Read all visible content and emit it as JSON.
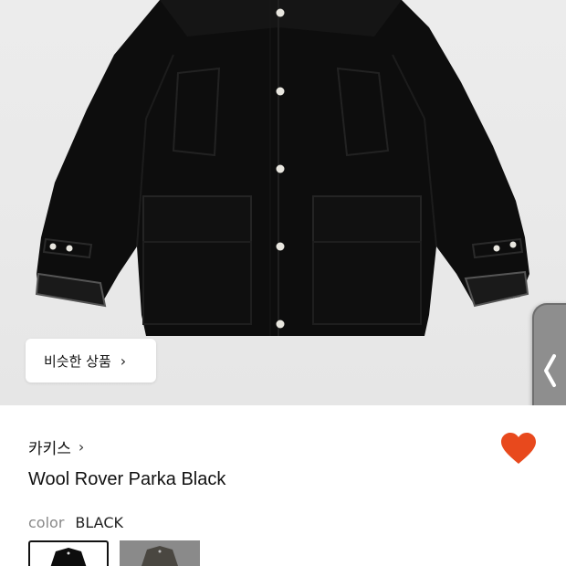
{
  "similar_products": {
    "label": "비슷한 상품",
    "chevron": "›"
  },
  "product": {
    "brand": "카키스",
    "brand_chevron": "›",
    "name": "Wool Rover Parka Black",
    "color_label": "color",
    "color_value": "BLACK"
  },
  "icons": {
    "wishlist": "heart-icon",
    "side_handle": "chevron-left-icon",
    "brand": "chevron-right-icon"
  },
  "colors": {
    "accent": "#E8491D",
    "jacket": "#0c0c0c",
    "swatch_grey": "#8a8a8a"
  }
}
